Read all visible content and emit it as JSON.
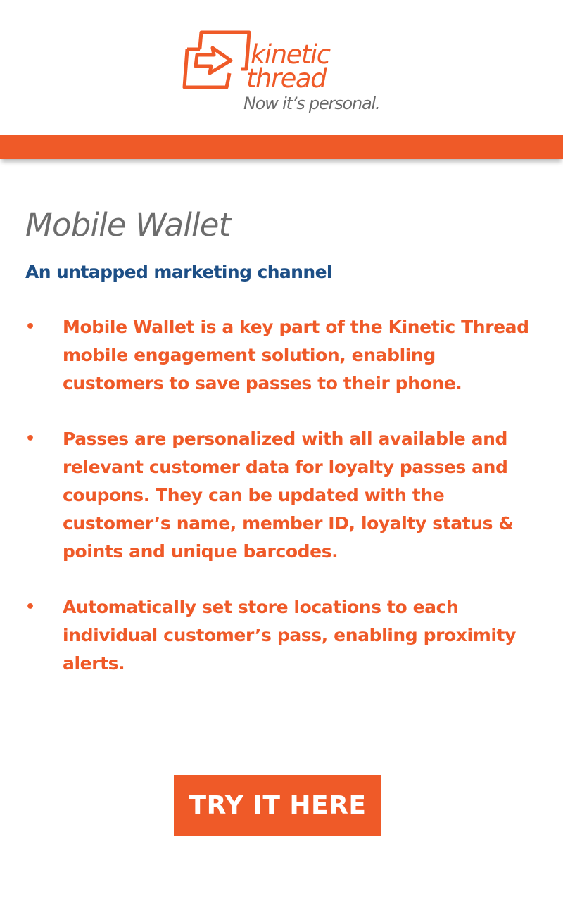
{
  "brand": {
    "name_line1": "kinetic",
    "name_line2": "thread",
    "tagline": "Now it’s personal.",
    "accent_color": "#ef5a28",
    "logo_icon": "arrow-in-box-icon"
  },
  "main": {
    "title": "Mobile Wallet",
    "subtitle": "An untapped marketing channel",
    "bullet_symbol": "•",
    "bullets": [
      "Mobile Wallet is a key part of the Kinetic Thread mobile engagement solution, enabling customers to save passes to their phone.",
      "Passes are personalized with all available and relevant customer data for loyalty passes and coupons. They can be updated with the customer’s name, member ID, loyalty status & points and unique barcodes.",
      "Automatically set store locations to each individual customer’s pass, enabling proximity alerts."
    ]
  },
  "cta": {
    "label": "TRY IT HERE"
  },
  "colors": {
    "title": "#6d6d6d",
    "subtitle": "#1d4f86",
    "body": "#ef5a28",
    "bar": "#ef5a28"
  }
}
